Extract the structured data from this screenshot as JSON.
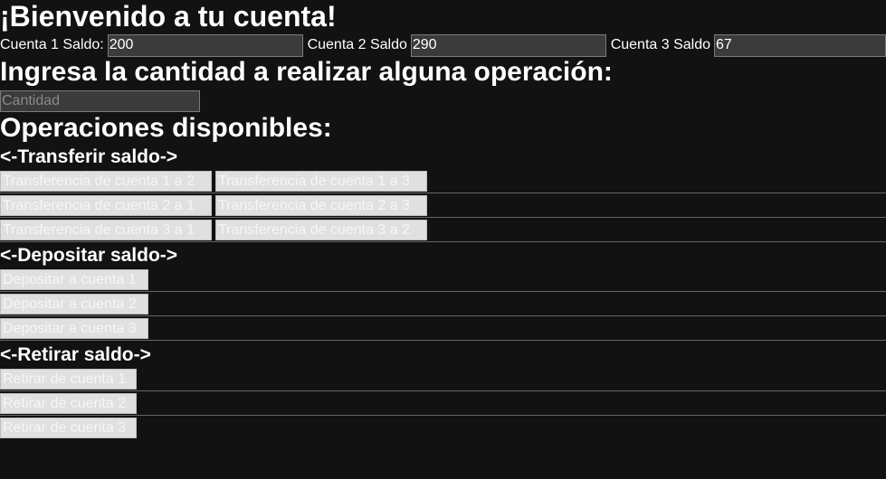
{
  "header": {
    "title": "¡Bienvenido a tu cuenta!"
  },
  "balances": {
    "account1": {
      "label": "Cuenta 1 Saldo:",
      "value": "200"
    },
    "account2": {
      "label": "Cuenta 2 Saldo",
      "value": "290"
    },
    "account3": {
      "label": "Cuenta 3 Saldo",
      "value": "67"
    }
  },
  "amount": {
    "heading": "Ingresa la cantidad a realizar alguna operación:",
    "placeholder": "Cantidad",
    "value": ""
  },
  "operations": {
    "heading": "Operaciones disponibles:",
    "transfer": {
      "heading": "<-Transferir saldo->",
      "buttons": [
        "Transferencia de cuenta 1 a 2",
        "Transferencia de cuenta 1 a 3",
        "Transferencia de cuenta 2 a 1",
        "Transferencia de cuenta 2 a 3",
        "Transferencia de cuenta 3 a 1",
        "Transferencia de cuenta 3 a 2"
      ]
    },
    "deposit": {
      "heading": "<-Depositar saldo->",
      "buttons": [
        "Depositar a cuenta 1",
        "Depositar a cuenta 2",
        "Depositar a cuenta 3"
      ]
    },
    "withdraw": {
      "heading": "<-Retirar saldo->",
      "buttons": [
        "Retirar de cuenta 1",
        "Retirar de cuenta 2",
        "Retirar de cuenta 3"
      ]
    }
  }
}
